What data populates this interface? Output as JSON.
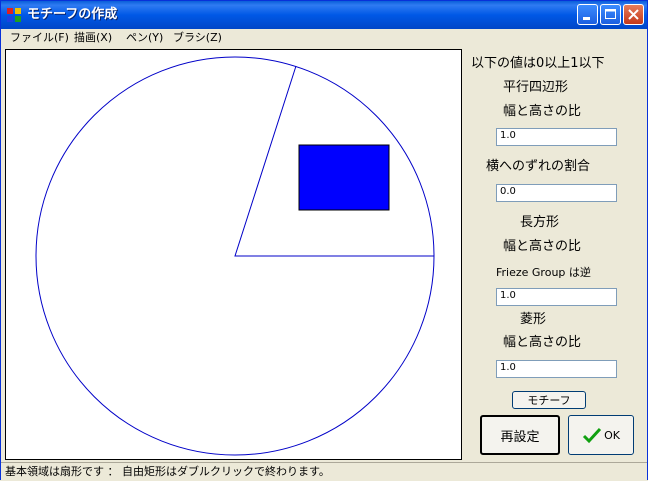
{
  "window": {
    "title": "モチーフの作成"
  },
  "menu": [
    "ファイル(F)",
    "描画(X)",
    "ペン(Y)",
    "ブラシ(Z)"
  ],
  "panel": {
    "range_note": "以下の値は0以上1以下",
    "parallelogram": {
      "heading": "平行四辺形",
      "ratio_label": "幅と高さの比",
      "ratio_value": "1.0",
      "shift_label": "横へのずれの割合",
      "shift_value": "0.0"
    },
    "rectangle": {
      "heading": "長方形",
      "ratio_label": "幅と高さの比",
      "frieze_note": "Frieze Group は逆",
      "ratio_value": "1.0"
    },
    "rhombus": {
      "heading": "菱形",
      "ratio_label": "幅と高さの比",
      "ratio_value": "1.0"
    },
    "motif_button": "モチーフ",
    "reset_button": "再設定",
    "ok_button": "OK"
  },
  "status": "基本領域は扇形です ： 自由矩形はダブルクリックで終わります。",
  "colors": {
    "circle": "#0000c8",
    "motif_rect": "#0000ff",
    "titlebar": "#0058e6"
  }
}
